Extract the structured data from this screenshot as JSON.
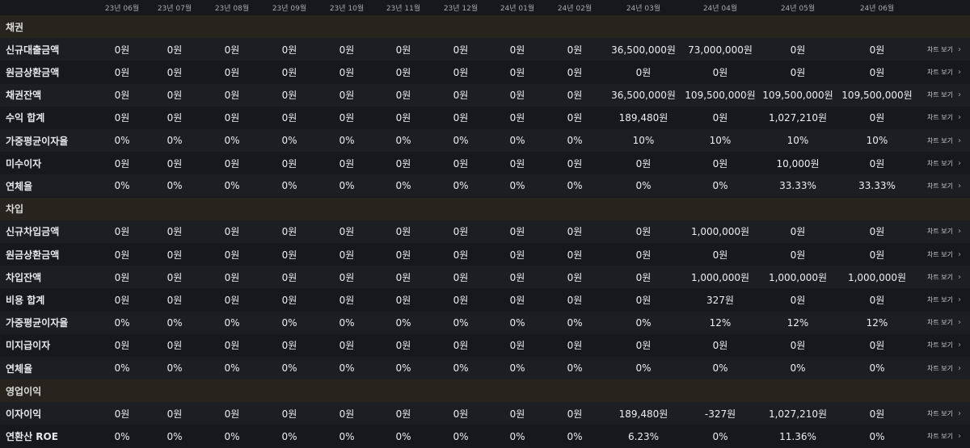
{
  "months": [
    "23년 06월",
    "23년 07월",
    "23년 08월",
    "23년 09월",
    "23년 10월",
    "23년 11월",
    "23년 12월",
    "24년 01월",
    "24년 02월",
    "24년 03월",
    "24년 04월",
    "24년 05월",
    "24년 06월"
  ],
  "chart_link_label": "차트 보기",
  "chevron": "›",
  "rows": [
    {
      "kind": "section",
      "label": "채권"
    },
    {
      "kind": "data",
      "label": "신규대출금액",
      "values": [
        "0원",
        "0원",
        "0원",
        "0원",
        "0원",
        "0원",
        "0원",
        "0원",
        "0원",
        "36,500,000원",
        "73,000,000원",
        "0원",
        "0원"
      ]
    },
    {
      "kind": "data",
      "label": "원금상환금액",
      "values": [
        "0원",
        "0원",
        "0원",
        "0원",
        "0원",
        "0원",
        "0원",
        "0원",
        "0원",
        "0원",
        "0원",
        "0원",
        "0원"
      ]
    },
    {
      "kind": "data",
      "label": "채권잔액",
      "values": [
        "0원",
        "0원",
        "0원",
        "0원",
        "0원",
        "0원",
        "0원",
        "0원",
        "0원",
        "36,500,000원",
        "109,500,000원",
        "109,500,000원",
        "109,500,000원"
      ]
    },
    {
      "kind": "data",
      "label": "수익 합계",
      "values": [
        "0원",
        "0원",
        "0원",
        "0원",
        "0원",
        "0원",
        "0원",
        "0원",
        "0원",
        "189,480원",
        "0원",
        "1,027,210원",
        "0원"
      ]
    },
    {
      "kind": "data",
      "label": "가중평균이자율",
      "values": [
        "0%",
        "0%",
        "0%",
        "0%",
        "0%",
        "0%",
        "0%",
        "0%",
        "0%",
        "10%",
        "10%",
        "10%",
        "10%"
      ]
    },
    {
      "kind": "data",
      "label": "미수이자",
      "values": [
        "0원",
        "0원",
        "0원",
        "0원",
        "0원",
        "0원",
        "0원",
        "0원",
        "0원",
        "0원",
        "0원",
        "10,000원",
        "0원"
      ]
    },
    {
      "kind": "data",
      "label": "연체율",
      "values": [
        "0%",
        "0%",
        "0%",
        "0%",
        "0%",
        "0%",
        "0%",
        "0%",
        "0%",
        "0%",
        "0%",
        "33.33%",
        "33.33%"
      ]
    },
    {
      "kind": "section",
      "label": "차입"
    },
    {
      "kind": "data",
      "label": "신규차입금액",
      "values": [
        "0원",
        "0원",
        "0원",
        "0원",
        "0원",
        "0원",
        "0원",
        "0원",
        "0원",
        "0원",
        "1,000,000원",
        "0원",
        "0원"
      ]
    },
    {
      "kind": "data",
      "label": "원금상환금액",
      "values": [
        "0원",
        "0원",
        "0원",
        "0원",
        "0원",
        "0원",
        "0원",
        "0원",
        "0원",
        "0원",
        "0원",
        "0원",
        "0원"
      ]
    },
    {
      "kind": "data",
      "label": "차입잔액",
      "values": [
        "0원",
        "0원",
        "0원",
        "0원",
        "0원",
        "0원",
        "0원",
        "0원",
        "0원",
        "0원",
        "1,000,000원",
        "1,000,000원",
        "1,000,000원"
      ]
    },
    {
      "kind": "data",
      "label": "비용 합계",
      "values": [
        "0원",
        "0원",
        "0원",
        "0원",
        "0원",
        "0원",
        "0원",
        "0원",
        "0원",
        "0원",
        "327원",
        "0원",
        "0원"
      ]
    },
    {
      "kind": "data",
      "label": "가중평균이자율",
      "values": [
        "0%",
        "0%",
        "0%",
        "0%",
        "0%",
        "0%",
        "0%",
        "0%",
        "0%",
        "0%",
        "12%",
        "12%",
        "12%"
      ]
    },
    {
      "kind": "data",
      "label": "미지급이자",
      "values": [
        "0원",
        "0원",
        "0원",
        "0원",
        "0원",
        "0원",
        "0원",
        "0원",
        "0원",
        "0원",
        "0원",
        "0원",
        "0원"
      ]
    },
    {
      "kind": "data",
      "label": "연체율",
      "values": [
        "0%",
        "0%",
        "0%",
        "0%",
        "0%",
        "0%",
        "0%",
        "0%",
        "0%",
        "0%",
        "0%",
        "0%",
        "0%"
      ]
    },
    {
      "kind": "section",
      "label": "영업이익"
    },
    {
      "kind": "data",
      "label": "이자이익",
      "values": [
        "0원",
        "0원",
        "0원",
        "0원",
        "0원",
        "0원",
        "0원",
        "0원",
        "0원",
        "189,480원",
        "-327원",
        "1,027,210원",
        "0원"
      ]
    },
    {
      "kind": "data",
      "label": "연환산 ROE",
      "values": [
        "0%",
        "0%",
        "0%",
        "0%",
        "0%",
        "0%",
        "0%",
        "0%",
        "0%",
        "6.23%",
        "0%",
        "11.36%",
        "0%"
      ]
    }
  ]
}
